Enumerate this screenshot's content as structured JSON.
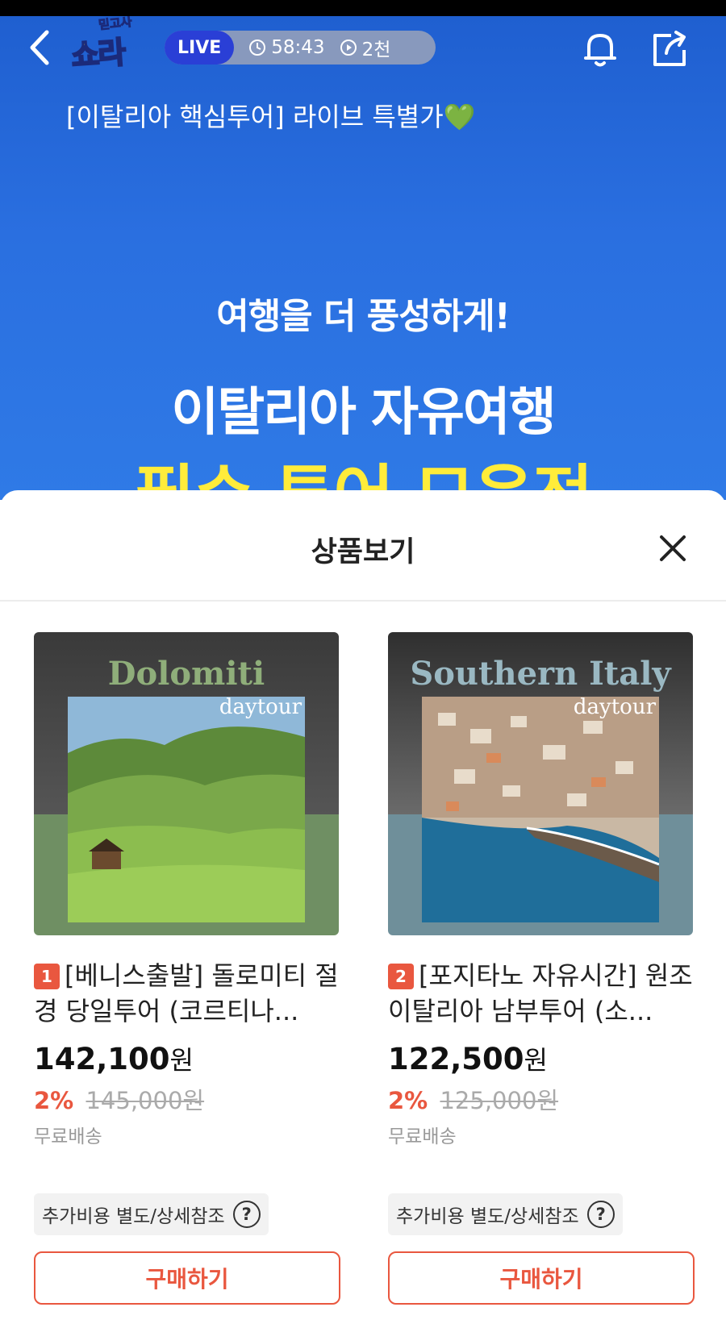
{
  "live": {
    "badge": "LIVE",
    "logo_small": "믿고사",
    "logo_main": "쇼라",
    "timer": "58:43",
    "views": "2천",
    "title": "[이탈리아 핵심투어] 라이브 특별가",
    "title_emoji": "💚"
  },
  "promo": {
    "sub": "여행을 더 풍성하게!",
    "main": "이탈리아 자유여행",
    "yellow": "필수 투어 모음전"
  },
  "sheet": {
    "title": "상품보기"
  },
  "products": [
    {
      "rank": "1",
      "thumb_title": "Dolomiti",
      "thumb_sub": "daytour",
      "name": "[베니스출발] 돌로미티 절경 당일투어 (코르티나...",
      "price": "142,100",
      "won": "원",
      "discount": "2%",
      "original_price": "145,000원",
      "shipping": "무료배송",
      "extra_cost": "추가비용 별도/상세참조",
      "help": "?",
      "buy": "구매하기"
    },
    {
      "rank": "2",
      "thumb_title": "Southern Italy",
      "thumb_sub": "daytour",
      "name": "[포지타노 자유시간] 원조 이탈리아 남부투어 (소...",
      "price": "122,500",
      "won": "원",
      "discount": "2%",
      "original_price": "125,000원",
      "shipping": "무료배송",
      "extra_cost": "추가비용 별도/상세참조",
      "help": "?",
      "buy": "구매하기"
    }
  ],
  "colors": {
    "accent": "#e9573f",
    "live_badge": "#2a3fd6",
    "video_bg": "#2a6fe0",
    "promo_yellow": "#ffec3a"
  },
  "icons": [
    "back-icon",
    "bell-icon",
    "share-icon",
    "clock-icon",
    "play-icon",
    "close-icon",
    "help-icon"
  ]
}
